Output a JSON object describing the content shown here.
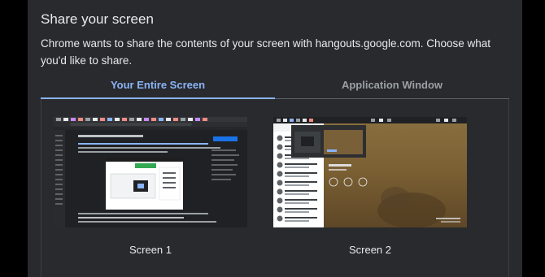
{
  "dialog": {
    "title": "Share your screen",
    "description": "Chrome wants to share the contents of your screen with hangouts.google.com. Choose what you'd like to share."
  },
  "tabs": [
    {
      "label": "Your Entire Screen",
      "active": true
    },
    {
      "label": "Application Window",
      "active": false
    }
  ],
  "screens": [
    {
      "label": "Screen 1",
      "preview": "browser-window-preview"
    },
    {
      "label": "Screen 2",
      "preview": "desktop-wallpaper-preview"
    }
  ],
  "colors": {
    "dialog_bg": "#292a2d",
    "accent": "#8ab4f8",
    "text": "#e8eaed",
    "muted": "#9aa0a6"
  }
}
